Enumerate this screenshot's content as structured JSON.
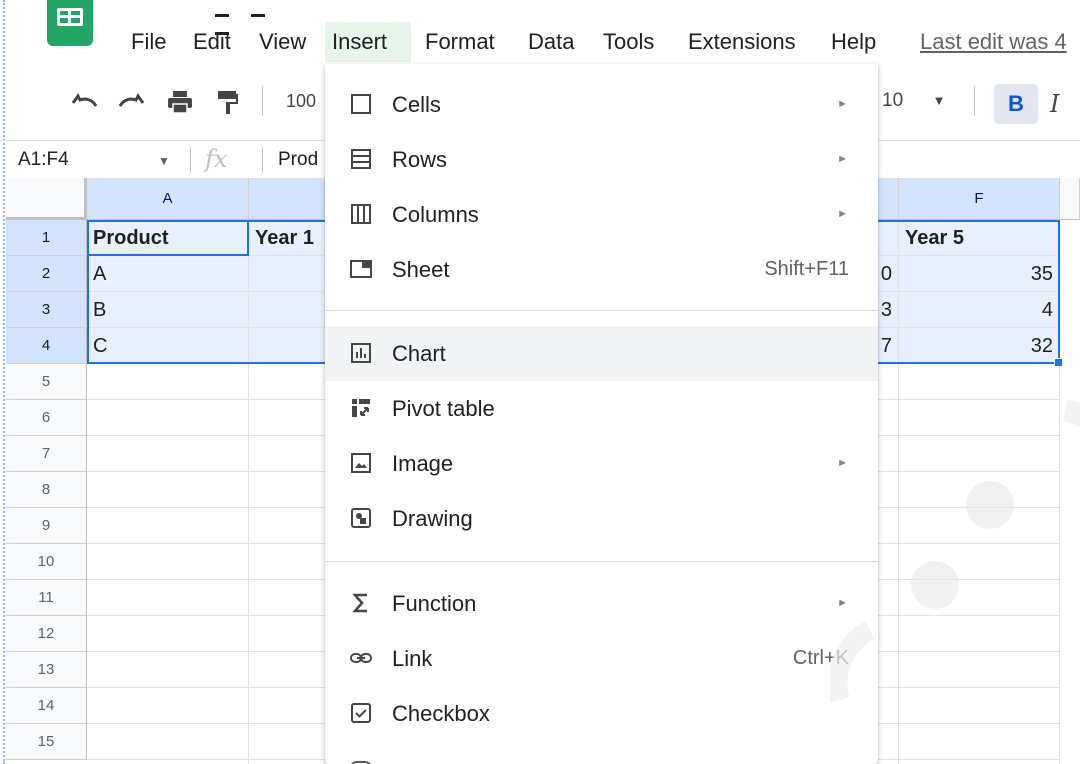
{
  "menubar": {
    "items": [
      "File",
      "Edit",
      "View",
      "Insert",
      "Format",
      "Data",
      "Tools",
      "Extensions",
      "Help"
    ],
    "last_edit": "Last edit was 4"
  },
  "toolbar": {
    "zoom": "100",
    "font_size": "10",
    "bold_label": "B",
    "italic_label": "I"
  },
  "formula_bar": {
    "name_box": "A1:F4",
    "fx": "fx",
    "content": "Prod"
  },
  "grid": {
    "columns": [
      "A",
      "F"
    ],
    "rows": [
      "1",
      "2",
      "3",
      "4",
      "5",
      "6",
      "7",
      "8",
      "9",
      "10",
      "11",
      "12",
      "13",
      "14",
      "15"
    ],
    "col_a": [
      "Product",
      "A",
      "B",
      "C"
    ],
    "col_b_header": "Year 1",
    "col_e_partial": [
      "0",
      "3",
      "7"
    ],
    "col_f": [
      "Year 5",
      "35",
      "4",
      "32"
    ]
  },
  "insert_menu": {
    "items": [
      {
        "label": "Cells",
        "icon": "cells-icon",
        "submenu": true
      },
      {
        "label": "Rows",
        "icon": "rows-icon",
        "submenu": true
      },
      {
        "label": "Columns",
        "icon": "columns-icon",
        "submenu": true
      },
      {
        "label": "Sheet",
        "icon": "sheet-icon",
        "shortcut": "Shift+F11"
      },
      {
        "label": "Chart",
        "icon": "chart-icon"
      },
      {
        "label": "Pivot table",
        "icon": "pivot-table-icon"
      },
      {
        "label": "Image",
        "icon": "image-icon",
        "submenu": true
      },
      {
        "label": "Drawing",
        "icon": "drawing-icon"
      },
      {
        "label": "Function",
        "icon": "function-icon",
        "submenu": true
      },
      {
        "label": "Link",
        "icon": "link-icon",
        "shortcut": "Ctrl+K"
      },
      {
        "label": "Checkbox",
        "icon": "checkbox-icon"
      }
    ],
    "submenu_glyph": "►"
  },
  "colors": {
    "sheets_green": "#23a566",
    "selection_blue": "#1a73e8",
    "selection_fill": "#e8f0fe",
    "menu_hover": "#f1f3f4"
  }
}
